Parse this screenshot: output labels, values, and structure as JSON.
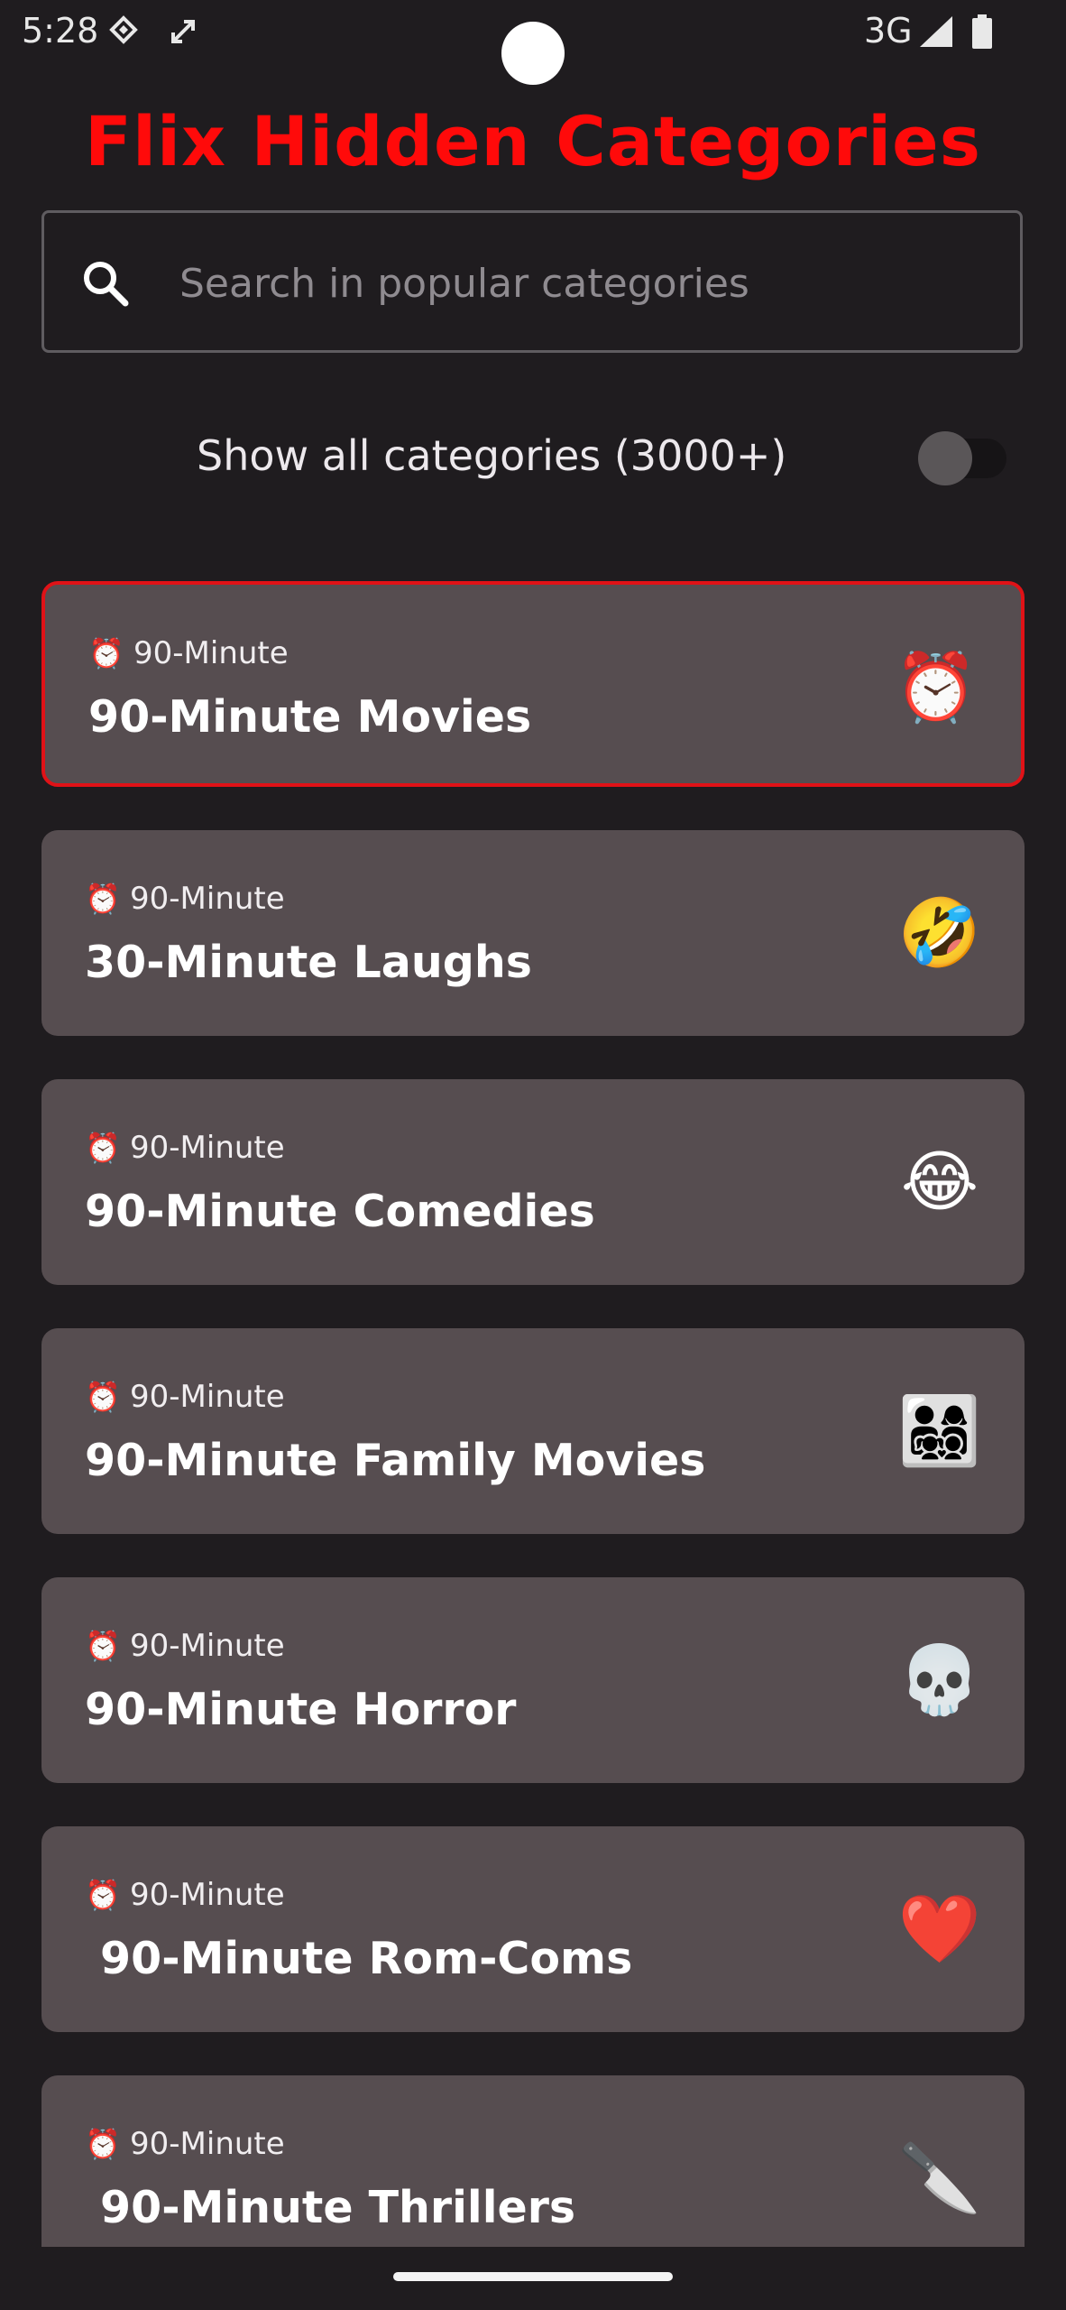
{
  "status_bar": {
    "time": "5:28",
    "network": "3G",
    "icons": [
      "data-saver-icon",
      "rotate-icon",
      "signal-icon",
      "battery-icon"
    ]
  },
  "header": {
    "title": "Flix Hidden Categories",
    "title_color": "#ff0a0a"
  },
  "search": {
    "placeholder": "Search in popular categories",
    "value": ""
  },
  "toggle": {
    "label": "Show all categories (3000+)",
    "checked": false
  },
  "categories": [
    {
      "tag": "90-Minute",
      "title": "90-Minute Movies",
      "emoji_icon": "alarm-clock-icon",
      "emoji": "⏰",
      "selected": true
    },
    {
      "tag": "90-Minute",
      "title": "30-Minute Laughs",
      "emoji_icon": "rolling-laughing-icon",
      "emoji": "🤣",
      "selected": false
    },
    {
      "tag": "90-Minute",
      "title": "90-Minute Comedies",
      "emoji_icon": "tears-of-joy-icon",
      "emoji": "😂",
      "selected": false
    },
    {
      "tag": "90-Minute",
      "title": "90-Minute Family Movies",
      "emoji_icon": "family-icon",
      "emoji": "👨‍👩‍👧‍👦",
      "selected": false
    },
    {
      "tag": "90-Minute",
      "title": "90-Minute Horror",
      "emoji_icon": "skull-icon",
      "emoji": "💀",
      "selected": false
    },
    {
      "tag": "90-Minute",
      "title": " 90-Minute Rom-Coms",
      "emoji_icon": "heart-icon",
      "emoji": "❤️",
      "selected": false
    },
    {
      "tag": "90-Minute",
      "title": " 90-Minute Thrillers",
      "emoji_icon": "knife-icon",
      "emoji": "🔪",
      "selected": false
    }
  ],
  "clock_emoji": "⏰",
  "colors": {
    "background": "#1f1c1f",
    "card": "#564d50",
    "selected_border": "#e01217"
  }
}
